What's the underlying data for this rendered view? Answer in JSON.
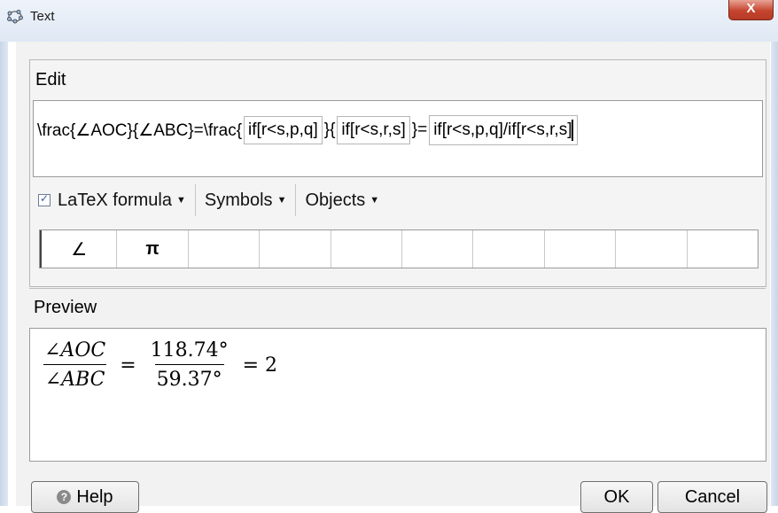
{
  "window": {
    "title": "Text",
    "icon": "geogebra-icon",
    "close_label": "X"
  },
  "edit": {
    "label": "Edit",
    "editor": {
      "segments": [
        {
          "type": "text",
          "value": "\\frac{∠AOC}{∠ABC}=\\frac{"
        },
        {
          "type": "dynamic",
          "value": "if[r<s,p,q]"
        },
        {
          "type": "text",
          "value": "}{"
        },
        {
          "type": "dynamic",
          "value": "if[r<s,r,s]"
        },
        {
          "type": "text",
          "value": "}="
        },
        {
          "type": "dynamic",
          "value": "if[r<s,p,q]/if[r<s,r,s]"
        }
      ]
    },
    "toolbar": {
      "latex_checked": true,
      "latex_label": "LaTeX formula",
      "symbols_label": "Symbols",
      "objects_label": "Objects"
    },
    "symbols": [
      "∠",
      "π",
      "",
      "",
      "",
      "",
      "",
      "",
      "",
      ""
    ]
  },
  "preview": {
    "label": "Preview",
    "formula": {
      "lhs_num": "∠AOC",
      "lhs_den": "∠ABC",
      "eq1": "=",
      "rhs_num": "118.74°",
      "rhs_den": "59.37°",
      "eq2": "= 2"
    }
  },
  "buttons": {
    "help": "Help",
    "ok": "OK",
    "cancel": "Cancel"
  }
}
